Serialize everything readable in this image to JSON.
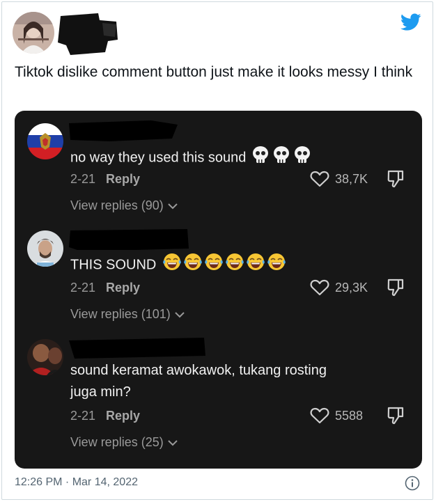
{
  "tweet": {
    "text": "Tiktok dislike comment button just make it looks messy I think",
    "timestamp": "12:26 PM · Mar 14, 2022"
  },
  "comments": [
    {
      "text": "no way they used this sound",
      "emoji": [
        "skull",
        "skull",
        "skull"
      ],
      "date": "2-21",
      "reply_label": "Reply",
      "likes": "38,7K",
      "view_replies": "View replies (90)"
    },
    {
      "text": "THIS SOUND",
      "emoji": [
        "laughing",
        "laughing",
        "laughing",
        "laughing",
        "laughing",
        "laughing"
      ],
      "date": "2-21",
      "reply_label": "Reply",
      "likes": "29,3K",
      "view_replies": "View replies (101)"
    },
    {
      "text": "sound keramat awokawok, tukang rosting juga min?",
      "emoji": [],
      "date": "2-21",
      "reply_label": "Reply",
      "likes": "5588",
      "view_replies": "View replies (25)"
    }
  ],
  "colors": {
    "twitter_blue": "#1d9bf0",
    "dark_panel": "#171717",
    "comment_text": "#f1f1f1",
    "muted_text": "#9a9a9a"
  },
  "icons": [
    "twitter-bird-icon",
    "heart-icon",
    "dislike-icon",
    "chevron-down-icon",
    "info-icon",
    "skull-emoji",
    "laughing-emoji"
  ]
}
